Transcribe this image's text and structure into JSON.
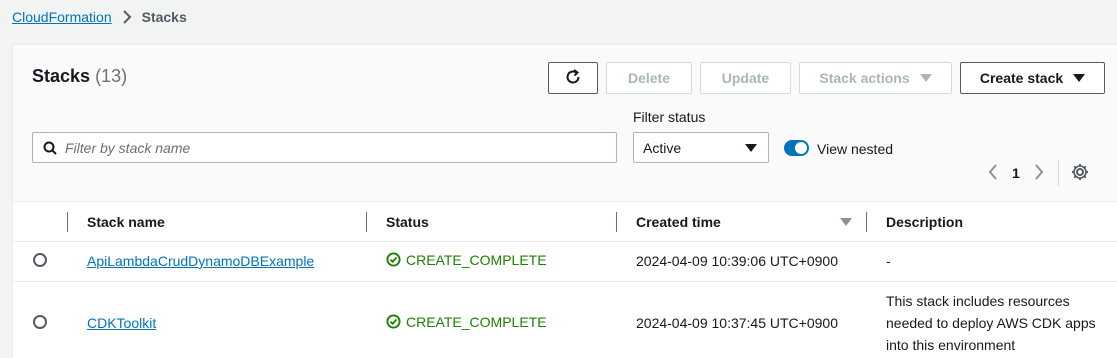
{
  "breadcrumb": {
    "root": "CloudFormation",
    "current": "Stacks"
  },
  "header": {
    "title": "Stacks",
    "count": "(13)"
  },
  "toolbar": {
    "delete_label": "Delete",
    "update_label": "Update",
    "stack_actions_label": "Stack actions",
    "create_stack_label": "Create stack"
  },
  "search": {
    "placeholder": "Filter by stack name",
    "value": ""
  },
  "filter_status": {
    "label": "Filter status",
    "value": "Active"
  },
  "view_nested": {
    "label": "View nested",
    "enabled": true
  },
  "pagination": {
    "current_page": "1"
  },
  "table": {
    "columns": [
      "Stack name",
      "Status",
      "Created time",
      "Description"
    ],
    "rows": [
      {
        "name": "ApiLambdaCrudDynamoDBExample",
        "status": "CREATE_COMPLETE",
        "created": "2024-04-09 10:39:06 UTC+0900",
        "description": "-"
      },
      {
        "name": "CDKToolkit",
        "status": "CREATE_COMPLETE",
        "created": "2024-04-09 10:37:45 UTC+0900",
        "description_lines": [
          "This stack includes resources",
          "needed to deploy AWS CDK apps",
          "into this environment"
        ]
      }
    ]
  },
  "colors": {
    "link": "#0073bb",
    "success": "#1d8102",
    "toggle": "#0073bb"
  }
}
